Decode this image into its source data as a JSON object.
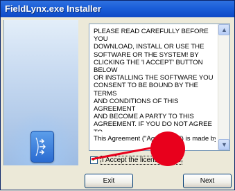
{
  "window": {
    "title": "FieldLynx.exe Installer"
  },
  "license": {
    "text": "PLEASE READ CAREFULLY BEFORE YOU\nDOWNLOAD, INSTALL OR USE THE\nSOFTWARE OR THE SYSTEM! BY\nCLICKING THE 'I ACCEPT' BUTTON BELOW\nOR INSTALLING THE SOFTWARE YOU\nCONSENT TO BE BOUND BY THE TERMS\nAND CONDITIONS OF THIS AGREEMENT\nAND BECOME A PARTY TO THIS\nAGREEMENT.  IF YOU DO NOT AGREE TO\nALL THE TERMS OF THIS AGREEMENT,\nCLICK ON THE 'I DO NOT ACCEPT'\nBUTTON AND YOU MUST NOT INSTALL\nOR USE THE SOFTWARE OR THE\nSYSTEM.",
    "tail": "This Agreement (\"Agreement\") is made by"
  },
  "accept": {
    "label": "I Accept the license terms",
    "checked": true
  },
  "buttons": {
    "exit": "Exit",
    "next": "Next"
  },
  "icons": {
    "scroll_up": "scroll-up-arrow",
    "scroll_down": "scroll-down-arrow",
    "logo": "installer-logo"
  },
  "colors": {
    "title_bar": "#1B5ED8",
    "marker": "#E8001C"
  }
}
